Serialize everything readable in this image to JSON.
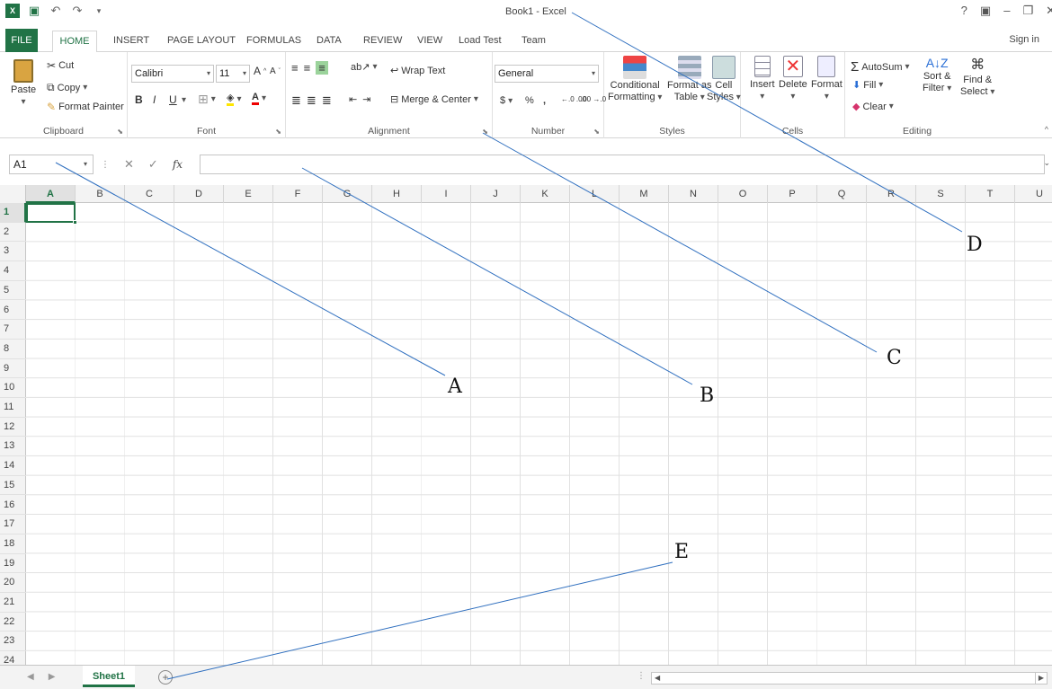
{
  "window": {
    "title": "Book1 - Excel"
  },
  "qat": {
    "save_icon": "save-icon",
    "undo_icon": "undo-icon",
    "redo_icon": "redo-icon"
  },
  "window_controls": {
    "help": "?",
    "options": "▣",
    "minimize": "–",
    "restore": "❐",
    "close": "✕"
  },
  "tabs": [
    "FILE",
    "HOME",
    "INSERT",
    "PAGE LAYOUT",
    "FORMULAS",
    "DATA",
    "REVIEW",
    "VIEW",
    "Load Test",
    "Team"
  ],
  "signin": "Sign in",
  "ribbon": {
    "clipboard": {
      "label": "Clipboard",
      "paste": "Paste",
      "cut": "Cut",
      "copy": "Copy",
      "format_painter": "Format Painter"
    },
    "font": {
      "label": "Font",
      "name": "Calibri",
      "size": "11",
      "bold": "B",
      "italic": "I",
      "underline": "U"
    },
    "alignment": {
      "label": "Alignment",
      "wrap_text": "Wrap Text",
      "merge_center": "Merge & Center"
    },
    "number": {
      "label": "Number",
      "format": "General",
      "currency": "$",
      "percent": "%",
      "comma": ",",
      "inc_dec": "←.0 .00",
      "dec_dec": ".00 →.0"
    },
    "styles": {
      "label": "Styles",
      "conditional_1": "Conditional",
      "conditional_2": "Formatting",
      "format_table_1": "Format as",
      "format_table_2": "Table",
      "cell_styles_1": "Cell",
      "cell_styles_2": "Styles"
    },
    "cells": {
      "label": "Cells",
      "insert": "Insert",
      "delete": "Delete",
      "format": "Format"
    },
    "editing": {
      "label": "Editing",
      "autosum": "AutoSum",
      "fill": "Fill",
      "clear": "Clear",
      "sort_1": "Sort &",
      "sort_2": "Filter",
      "find_1": "Find &",
      "find_2": "Select"
    }
  },
  "formula_bar": {
    "name_box": "A1",
    "cancel": "✕",
    "enter": "✓",
    "fx": "fx",
    "value": ""
  },
  "columns": [
    "A",
    "B",
    "C",
    "D",
    "E",
    "F",
    "G",
    "H",
    "I",
    "J",
    "K",
    "L",
    "M",
    "N",
    "O",
    "P",
    "Q",
    "R",
    "S",
    "T",
    "U"
  ],
  "rows": [
    "1",
    "2",
    "3",
    "4",
    "5",
    "6",
    "7",
    "8",
    "9",
    "10",
    "11",
    "12",
    "13",
    "14",
    "15",
    "16",
    "17",
    "18",
    "19",
    "20",
    "21",
    "22",
    "23",
    "24"
  ],
  "sheets": {
    "active": "Sheet1",
    "add": "+"
  },
  "annotations": [
    "A",
    "B",
    "C",
    "D",
    "E"
  ]
}
